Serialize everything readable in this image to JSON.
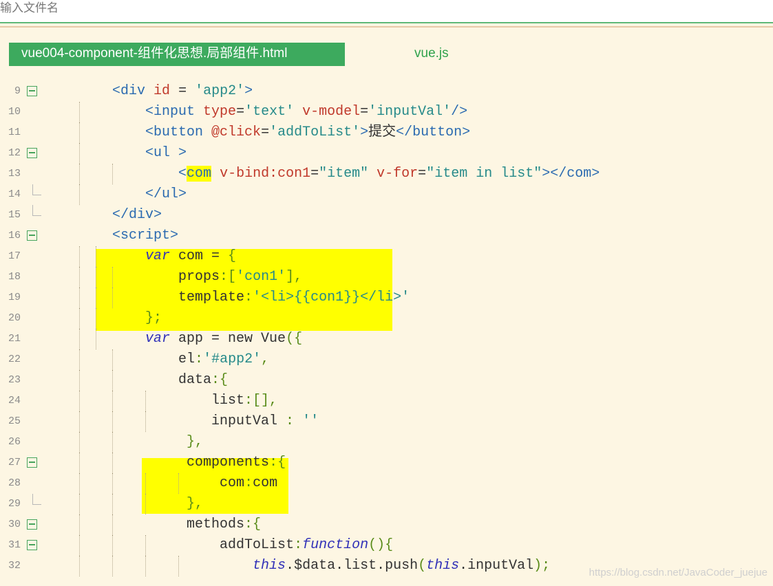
{
  "search": {
    "placeholder": "输入文件名"
  },
  "tabs": [
    {
      "label": "vue004-component-组件化思想.局部组件.html",
      "active": true
    },
    {
      "label": "vue.js",
      "active": false
    }
  ],
  "lines": [
    {
      "n": "9",
      "fold": "box",
      "segs": [
        [
          "    ",
          "p"
        ],
        [
          "<",
          "tag"
        ],
        [
          "div ",
          "tag"
        ],
        [
          "id",
          "attr"
        ],
        [
          " = ",
          "p"
        ],
        [
          "'app2'",
          "str"
        ],
        [
          ">",
          "tag"
        ]
      ]
    },
    {
      "n": "10",
      "fold": "",
      "segs": [
        [
          "        ",
          "p"
        ],
        [
          "<",
          "tag"
        ],
        [
          "input ",
          "tag"
        ],
        [
          "type",
          "attr"
        ],
        [
          "=",
          "p"
        ],
        [
          "'text'",
          "str"
        ],
        [
          " ",
          "p"
        ],
        [
          "v-model",
          "attr"
        ],
        [
          "=",
          "p"
        ],
        [
          "'inputVal'",
          "str"
        ],
        [
          "/>",
          "tag"
        ]
      ]
    },
    {
      "n": "11",
      "fold": "",
      "segs": [
        [
          "        ",
          "p"
        ],
        [
          "<",
          "tag"
        ],
        [
          "button ",
          "tag"
        ],
        [
          "@click",
          "attr"
        ],
        [
          "=",
          "p"
        ],
        [
          "'addToList'",
          "str"
        ],
        [
          ">",
          "tag"
        ],
        [
          "提交",
          "plain"
        ],
        [
          "</",
          "tag"
        ],
        [
          "button",
          "tag"
        ],
        [
          ">",
          "tag"
        ]
      ]
    },
    {
      "n": "12",
      "fold": "box",
      "segs": [
        [
          "        ",
          "p"
        ],
        [
          "<",
          "tag"
        ],
        [
          "ul ",
          "tag"
        ],
        [
          ">",
          "tag"
        ]
      ]
    },
    {
      "n": "13",
      "fold": "",
      "segs": [
        [
          "            ",
          "p"
        ],
        [
          "<",
          "tag"
        ],
        [
          "com",
          "hl"
        ],
        [
          " ",
          "p"
        ],
        [
          "v-bind:con1",
          "attr"
        ],
        [
          "=",
          "p"
        ],
        [
          "\"item\"",
          "str"
        ],
        [
          " ",
          "p"
        ],
        [
          "v-for",
          "attr"
        ],
        [
          "=",
          "p"
        ],
        [
          "\"item in list\"",
          "str"
        ],
        [
          "></",
          "tag"
        ],
        [
          "com",
          "tag"
        ],
        [
          ">",
          "tag"
        ]
      ]
    },
    {
      "n": "14",
      "fold": "tick",
      "segs": [
        [
          "        ",
          "p"
        ],
        [
          "</",
          "tag"
        ],
        [
          "ul",
          "tag"
        ],
        [
          ">",
          "tag"
        ]
      ]
    },
    {
      "n": "15",
      "fold": "tick",
      "segs": [
        [
          "    ",
          "p"
        ],
        [
          "</",
          "tag"
        ],
        [
          "div",
          "tag"
        ],
        [
          ">",
          "tag"
        ]
      ]
    },
    {
      "n": "16",
      "fold": "box",
      "segs": [
        [
          "    ",
          "p"
        ],
        [
          "<",
          "tag"
        ],
        [
          "script",
          "tag"
        ],
        [
          ">",
          "tag"
        ]
      ]
    },
    {
      "n": "17",
      "fold": "",
      "segs": [
        [
          "        ",
          "p"
        ],
        [
          "var",
          "kw"
        ],
        [
          " com = ",
          "plain"
        ],
        [
          "{",
          "punc"
        ]
      ]
    },
    {
      "n": "18",
      "fold": "",
      "segs": [
        [
          "            ",
          "p"
        ],
        [
          "props",
          "plain"
        ],
        [
          ":[",
          "punc"
        ],
        [
          "'con1'",
          "str"
        ],
        [
          "],",
          "punc"
        ]
      ]
    },
    {
      "n": "19",
      "fold": "",
      "segs": [
        [
          "            ",
          "p"
        ],
        [
          "template",
          "plain"
        ],
        [
          ":",
          "punc"
        ],
        [
          "'<li>{{con1}}</li>'",
          "str"
        ]
      ]
    },
    {
      "n": "20",
      "fold": "",
      "segs": [
        [
          "        ",
          "p"
        ],
        [
          "};",
          "punc"
        ]
      ]
    },
    {
      "n": "21",
      "fold": "",
      "segs": [
        [
          "        ",
          "p"
        ],
        [
          "var",
          "kw"
        ],
        [
          " app = new Vue",
          "plain"
        ],
        [
          "({",
          "punc"
        ]
      ]
    },
    {
      "n": "22",
      "fold": "",
      "segs": [
        [
          "            ",
          "p"
        ],
        [
          "el",
          "plain"
        ],
        [
          ":",
          "punc"
        ],
        [
          "'#app2'",
          "str"
        ],
        [
          ",",
          "punc"
        ]
      ]
    },
    {
      "n": "23",
      "fold": "",
      "segs": [
        [
          "            ",
          "p"
        ],
        [
          "data",
          "plain"
        ],
        [
          ":{",
          "punc"
        ]
      ]
    },
    {
      "n": "24",
      "fold": "",
      "segs": [
        [
          "                ",
          "p"
        ],
        [
          "list",
          "plain"
        ],
        [
          ":[],",
          "punc"
        ]
      ]
    },
    {
      "n": "25",
      "fold": "",
      "segs": [
        [
          "                ",
          "p"
        ],
        [
          "inputVal",
          "plain"
        ],
        [
          " : ",
          "punc"
        ],
        [
          "''",
          "str"
        ]
      ]
    },
    {
      "n": "26",
      "fold": "",
      "segs": [
        [
          "             ",
          "p"
        ],
        [
          "},",
          "punc"
        ]
      ]
    },
    {
      "n": "27",
      "fold": "box",
      "segs": [
        [
          "             ",
          "p"
        ],
        [
          "components",
          "plain"
        ],
        [
          ":{",
          "punc"
        ]
      ]
    },
    {
      "n": "28",
      "fold": "",
      "segs": [
        [
          "                 ",
          "p"
        ],
        [
          "com",
          "plain"
        ],
        [
          ":",
          "punc"
        ],
        [
          "com",
          "plain"
        ]
      ]
    },
    {
      "n": "29",
      "fold": "tick",
      "segs": [
        [
          "             ",
          "p"
        ],
        [
          "},",
          "punc"
        ]
      ]
    },
    {
      "n": "30",
      "fold": "box",
      "segs": [
        [
          "             ",
          "p"
        ],
        [
          "methods",
          "plain"
        ],
        [
          ":{",
          "punc"
        ]
      ]
    },
    {
      "n": "31",
      "fold": "box",
      "segs": [
        [
          "                 ",
          "p"
        ],
        [
          "addToList",
          "plain"
        ],
        [
          ":",
          "punc"
        ],
        [
          "function",
          "fn"
        ],
        [
          "(){",
          "punc"
        ]
      ]
    },
    {
      "n": "32",
      "fold": "",
      "segs": [
        [
          "                     ",
          "p"
        ],
        [
          "this",
          "kw"
        ],
        [
          ".$data.list.push",
          "plain"
        ],
        [
          "(",
          "punc"
        ],
        [
          "this",
          "kw"
        ],
        [
          ".inputVal",
          "plain"
        ],
        [
          ");",
          "punc"
        ]
      ]
    }
  ],
  "watermark": "https://blog.csdn.net/JavaCoder_juejue",
  "colors": {
    "active_tab": "#3daa5e",
    "highlight": "#ffff00",
    "background": "#fdf6e3"
  }
}
